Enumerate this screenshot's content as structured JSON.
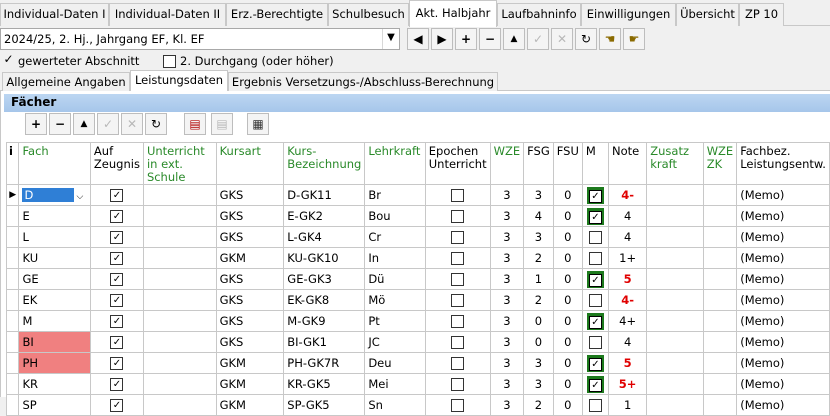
{
  "tabs": [
    "Individual-Daten I",
    "Individual-Daten II",
    "Erz.-Berechtigte",
    "Schulbesuch",
    "Akt. Halbjahr",
    "Laufbahninfo",
    "Einwilligungen",
    "Übersicht",
    "ZP 10"
  ],
  "selector": {
    "value": "2024/25, 2. Hj., Jahrgang EF, Kl. EF"
  },
  "checks": {
    "gewerteter": "gewerteter Abschnitt",
    "durchgang": "2. Durchgang (oder höher)"
  },
  "subtabs": [
    "Allgemeine Angaben",
    "Leistungsdaten",
    "Ergebnis Versetzungs-/Abschluss-Berechnung"
  ],
  "panel_title": "Fächer",
  "headers": {
    "idx": "i",
    "fach": "Fach",
    "auf": "Auf Zeugnis",
    "unt": "Unterricht in ext. Schule",
    "kurs": "Kursart",
    "kb": "Kurs-Bezeichnung",
    "lk": "Lehrkraft",
    "ep": "Epochen Unterricht",
    "wze": "WZE",
    "fsg": "FSG",
    "fsu": "FSU",
    "m": "M",
    "note": "Note",
    "zus": "Zusatz kraft",
    "wzezk": "WZE ZK",
    "fach2": "Fachbez. Leistungsentw."
  },
  "rows": [
    {
      "fach": "D",
      "kurs": "GKS",
      "kb": "D-GK11",
      "lk": "Br",
      "wze": "3",
      "fsg": "3",
      "fsu": "0",
      "m": true,
      "note": "4-",
      "red": true,
      "memo": "(Memo)"
    },
    {
      "fach": "E",
      "kurs": "GKS",
      "kb": "E-GK2",
      "lk": "Bou",
      "wze": "3",
      "fsg": "4",
      "fsu": "0",
      "m": true,
      "note": "4",
      "red": false,
      "memo": "(Memo)"
    },
    {
      "fach": "L",
      "kurs": "GKS",
      "kb": "L-GK4",
      "lk": "Cr",
      "wze": "3",
      "fsg": "3",
      "fsu": "0",
      "m": false,
      "note": "4",
      "red": false,
      "memo": "(Memo)"
    },
    {
      "fach": "KU",
      "kurs": "GKM",
      "kb": "KU-GK10",
      "lk": "In",
      "wze": "3",
      "fsg": "2",
      "fsu": "0",
      "m": false,
      "note": "1+",
      "red": false,
      "memo": "(Memo)"
    },
    {
      "fach": "GE",
      "kurs": "GKS",
      "kb": "GE-GK3",
      "lk": "Dü",
      "wze": "3",
      "fsg": "1",
      "fsu": "0",
      "m": true,
      "note": "5",
      "red": true,
      "memo": "(Memo)"
    },
    {
      "fach": "EK",
      "kurs": "GKS",
      "kb": "EK-GK8",
      "lk": "Mö",
      "wze": "3",
      "fsg": "2",
      "fsu": "0",
      "m": false,
      "note": "4-",
      "red": true,
      "memo": "(Memo)"
    },
    {
      "fach": "M",
      "kurs": "GKS",
      "kb": "M-GK9",
      "lk": "Pt",
      "wze": "3",
      "fsg": "0",
      "fsu": "0",
      "m": true,
      "note": "4+",
      "red": false,
      "memo": "(Memo)"
    },
    {
      "fach": "BI",
      "kurs": "GKS",
      "kb": "BI-GK1",
      "lk": "JC",
      "wze": "3",
      "fsg": "0",
      "fsu": "0",
      "m": false,
      "note": "4",
      "red": false,
      "memo": "(Memo)",
      "pink": true
    },
    {
      "fach": "PH",
      "kurs": "GKM",
      "kb": "PH-GK7R",
      "lk": "Deu",
      "wze": "3",
      "fsg": "3",
      "fsu": "0",
      "m": true,
      "note": "5",
      "red": true,
      "memo": "(Memo)",
      "pink": true
    },
    {
      "fach": "KR",
      "kurs": "GKM",
      "kb": "KR-GK5",
      "lk": "Mei",
      "wze": "3",
      "fsg": "3",
      "fsu": "0",
      "m": true,
      "note": "5+",
      "red": true,
      "memo": "(Memo)"
    },
    {
      "fach": "SP",
      "kurs": "GKM",
      "kb": "SP-GK5",
      "lk": "Sn",
      "wze": "3",
      "fsg": "2",
      "fsu": "0",
      "m": false,
      "note": "1",
      "red": false,
      "memo": "(Memo)"
    }
  ]
}
